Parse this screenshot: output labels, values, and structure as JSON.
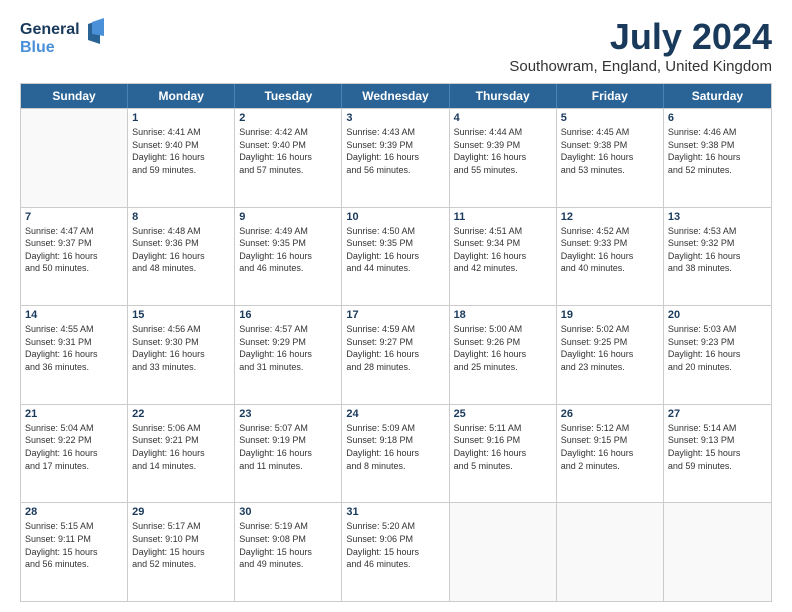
{
  "logo": {
    "line1": "General",
    "line2": "Blue"
  },
  "title": "July 2024",
  "location": "Southowram, England, United Kingdom",
  "header_days": [
    "Sunday",
    "Monday",
    "Tuesday",
    "Wednesday",
    "Thursday",
    "Friday",
    "Saturday"
  ],
  "rows": [
    [
      {
        "day": "",
        "text": ""
      },
      {
        "day": "1",
        "text": "Sunrise: 4:41 AM\nSunset: 9:40 PM\nDaylight: 16 hours\nand 59 minutes."
      },
      {
        "day": "2",
        "text": "Sunrise: 4:42 AM\nSunset: 9:40 PM\nDaylight: 16 hours\nand 57 minutes."
      },
      {
        "day": "3",
        "text": "Sunrise: 4:43 AM\nSunset: 9:39 PM\nDaylight: 16 hours\nand 56 minutes."
      },
      {
        "day": "4",
        "text": "Sunrise: 4:44 AM\nSunset: 9:39 PM\nDaylight: 16 hours\nand 55 minutes."
      },
      {
        "day": "5",
        "text": "Sunrise: 4:45 AM\nSunset: 9:38 PM\nDaylight: 16 hours\nand 53 minutes."
      },
      {
        "day": "6",
        "text": "Sunrise: 4:46 AM\nSunset: 9:38 PM\nDaylight: 16 hours\nand 52 minutes."
      }
    ],
    [
      {
        "day": "7",
        "text": "Sunrise: 4:47 AM\nSunset: 9:37 PM\nDaylight: 16 hours\nand 50 minutes."
      },
      {
        "day": "8",
        "text": "Sunrise: 4:48 AM\nSunset: 9:36 PM\nDaylight: 16 hours\nand 48 minutes."
      },
      {
        "day": "9",
        "text": "Sunrise: 4:49 AM\nSunset: 9:35 PM\nDaylight: 16 hours\nand 46 minutes."
      },
      {
        "day": "10",
        "text": "Sunrise: 4:50 AM\nSunset: 9:35 PM\nDaylight: 16 hours\nand 44 minutes."
      },
      {
        "day": "11",
        "text": "Sunrise: 4:51 AM\nSunset: 9:34 PM\nDaylight: 16 hours\nand 42 minutes."
      },
      {
        "day": "12",
        "text": "Sunrise: 4:52 AM\nSunset: 9:33 PM\nDaylight: 16 hours\nand 40 minutes."
      },
      {
        "day": "13",
        "text": "Sunrise: 4:53 AM\nSunset: 9:32 PM\nDaylight: 16 hours\nand 38 minutes."
      }
    ],
    [
      {
        "day": "14",
        "text": "Sunrise: 4:55 AM\nSunset: 9:31 PM\nDaylight: 16 hours\nand 36 minutes."
      },
      {
        "day": "15",
        "text": "Sunrise: 4:56 AM\nSunset: 9:30 PM\nDaylight: 16 hours\nand 33 minutes."
      },
      {
        "day": "16",
        "text": "Sunrise: 4:57 AM\nSunset: 9:29 PM\nDaylight: 16 hours\nand 31 minutes."
      },
      {
        "day": "17",
        "text": "Sunrise: 4:59 AM\nSunset: 9:27 PM\nDaylight: 16 hours\nand 28 minutes."
      },
      {
        "day": "18",
        "text": "Sunrise: 5:00 AM\nSunset: 9:26 PM\nDaylight: 16 hours\nand 25 minutes."
      },
      {
        "day": "19",
        "text": "Sunrise: 5:02 AM\nSunset: 9:25 PM\nDaylight: 16 hours\nand 23 minutes."
      },
      {
        "day": "20",
        "text": "Sunrise: 5:03 AM\nSunset: 9:23 PM\nDaylight: 16 hours\nand 20 minutes."
      }
    ],
    [
      {
        "day": "21",
        "text": "Sunrise: 5:04 AM\nSunset: 9:22 PM\nDaylight: 16 hours\nand 17 minutes."
      },
      {
        "day": "22",
        "text": "Sunrise: 5:06 AM\nSunset: 9:21 PM\nDaylight: 16 hours\nand 14 minutes."
      },
      {
        "day": "23",
        "text": "Sunrise: 5:07 AM\nSunset: 9:19 PM\nDaylight: 16 hours\nand 11 minutes."
      },
      {
        "day": "24",
        "text": "Sunrise: 5:09 AM\nSunset: 9:18 PM\nDaylight: 16 hours\nand 8 minutes."
      },
      {
        "day": "25",
        "text": "Sunrise: 5:11 AM\nSunset: 9:16 PM\nDaylight: 16 hours\nand 5 minutes."
      },
      {
        "day": "26",
        "text": "Sunrise: 5:12 AM\nSunset: 9:15 PM\nDaylight: 16 hours\nand 2 minutes."
      },
      {
        "day": "27",
        "text": "Sunrise: 5:14 AM\nSunset: 9:13 PM\nDaylight: 15 hours\nand 59 minutes."
      }
    ],
    [
      {
        "day": "28",
        "text": "Sunrise: 5:15 AM\nSunset: 9:11 PM\nDaylight: 15 hours\nand 56 minutes."
      },
      {
        "day": "29",
        "text": "Sunrise: 5:17 AM\nSunset: 9:10 PM\nDaylight: 15 hours\nand 52 minutes."
      },
      {
        "day": "30",
        "text": "Sunrise: 5:19 AM\nSunset: 9:08 PM\nDaylight: 15 hours\nand 49 minutes."
      },
      {
        "day": "31",
        "text": "Sunrise: 5:20 AM\nSunset: 9:06 PM\nDaylight: 15 hours\nand 46 minutes."
      },
      {
        "day": "",
        "text": ""
      },
      {
        "day": "",
        "text": ""
      },
      {
        "day": "",
        "text": ""
      }
    ]
  ]
}
